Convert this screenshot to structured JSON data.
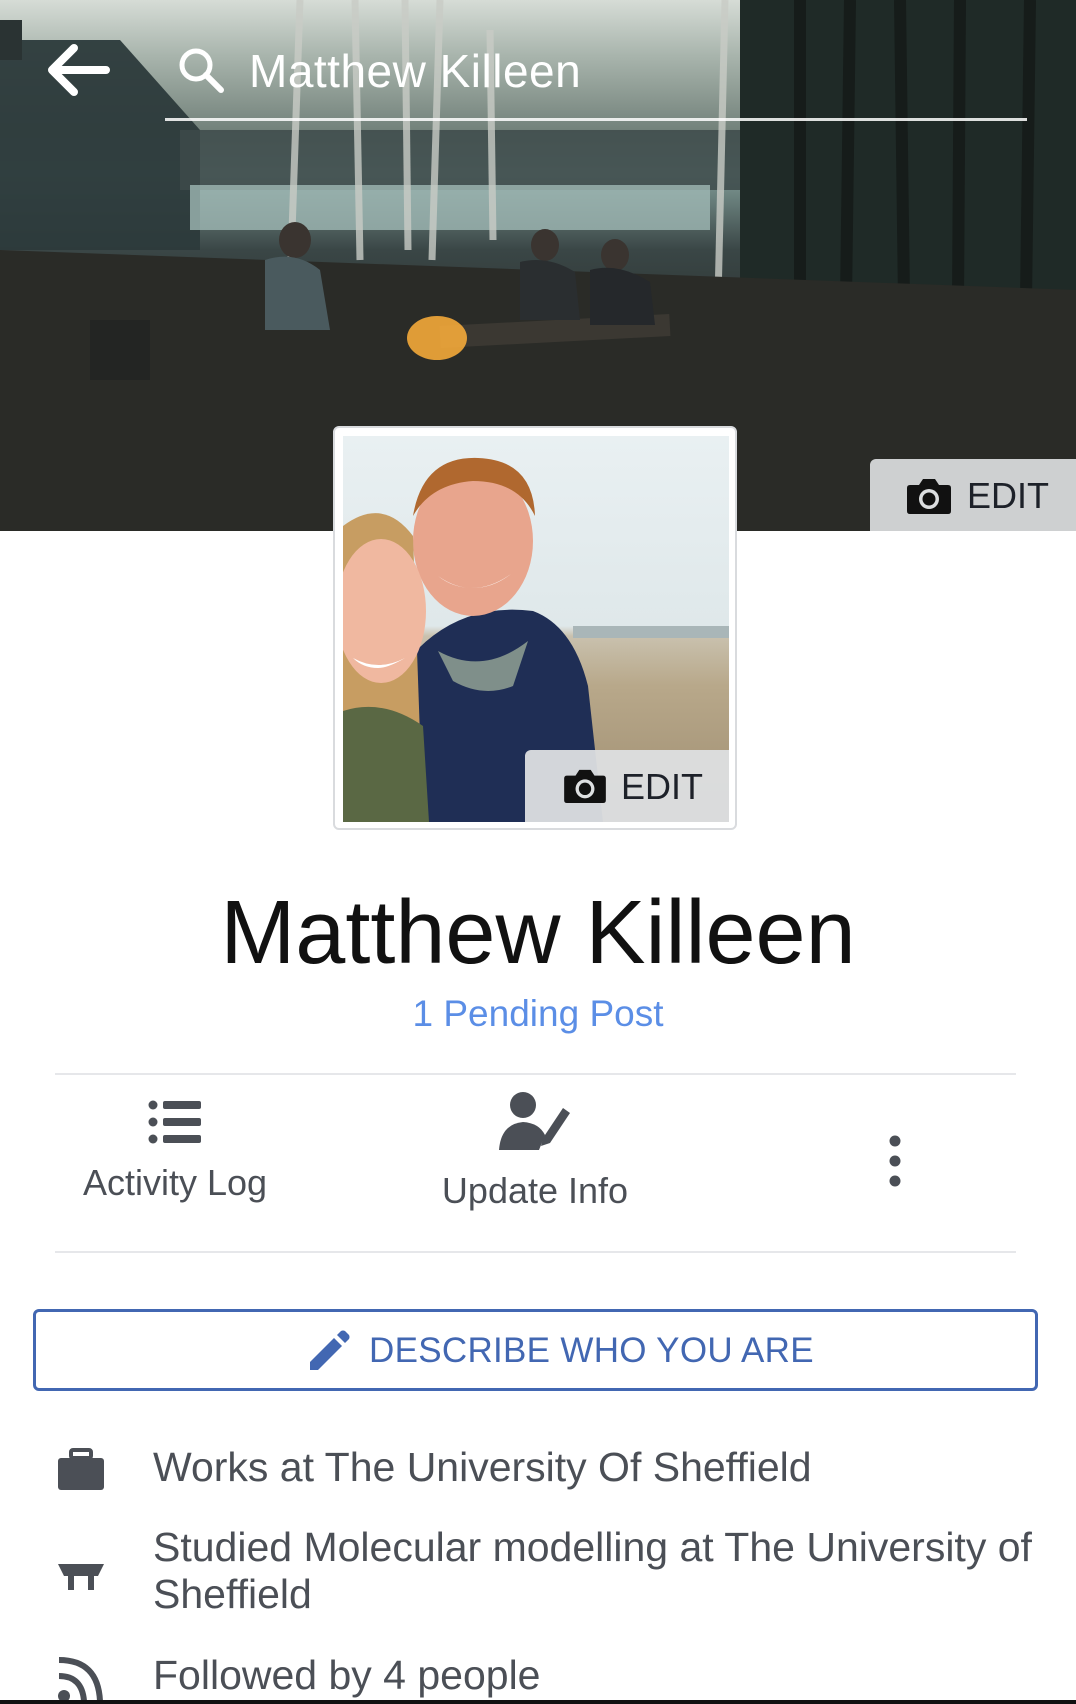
{
  "header": {
    "search_value": "Matthew Killeen"
  },
  "cover": {
    "edit_label": "EDIT"
  },
  "profile": {
    "edit_label": "EDIT",
    "name": "Matthew Killeen",
    "pending": "1 Pending Post"
  },
  "actions": [
    {
      "label": "Activity Log",
      "icon": "list-icon"
    },
    {
      "label": "Update Info",
      "icon": "edit-profile-icon"
    },
    {
      "label": "",
      "icon": "more-vertical-icon"
    }
  ],
  "describe_button": {
    "label": "DESCRIBE WHO YOU ARE",
    "icon": "pencil-icon"
  },
  "info": [
    {
      "icon": "briefcase-icon",
      "text": "Works at The University Of Sheffield"
    },
    {
      "icon": "graduation-cap-icon",
      "text": "Studied Molecular modelling at The University of Sheffield"
    },
    {
      "icon": "rss-feed-icon",
      "text": "Followed by 4 people"
    }
  ],
  "colors": {
    "link_blue": "#5b8ee6",
    "brand_blue": "#4267b2",
    "text_gray": "#4b4f56"
  }
}
